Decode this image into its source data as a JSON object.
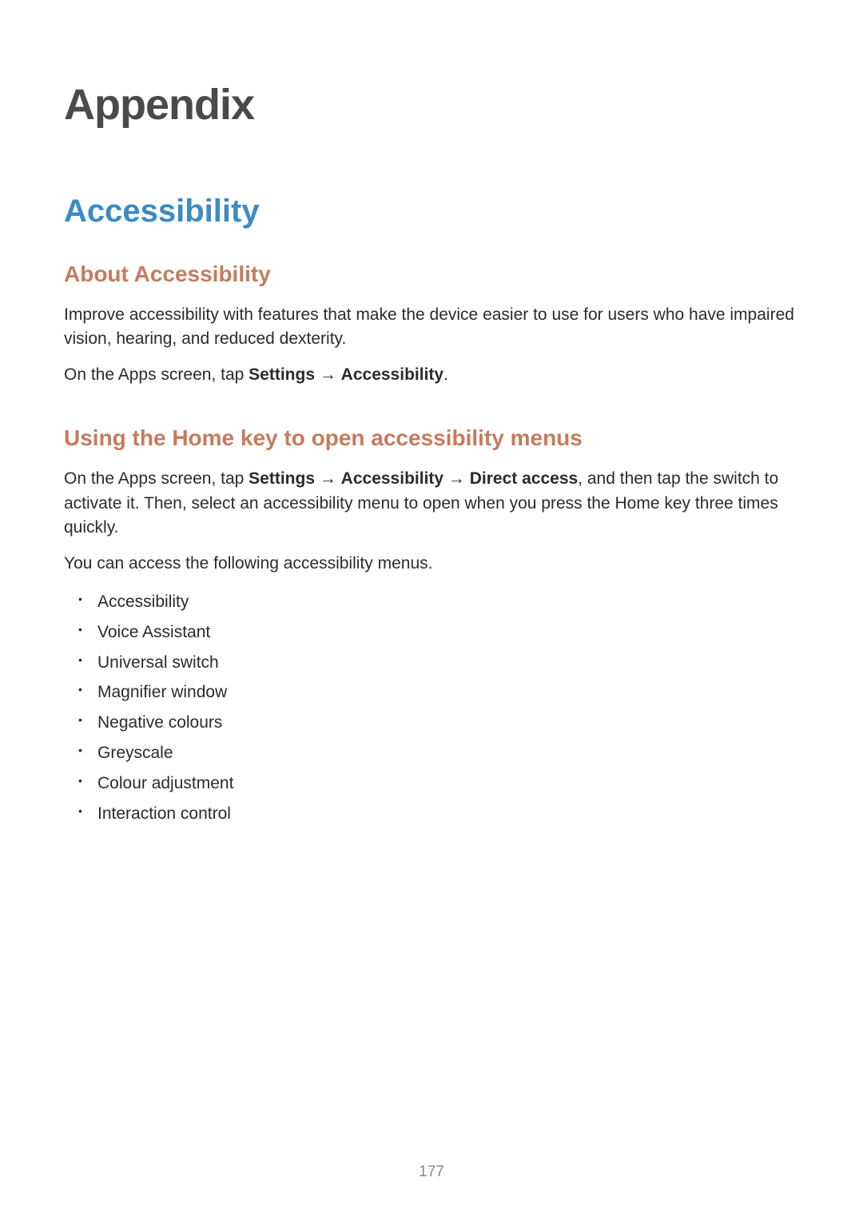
{
  "chapterTitle": "Appendix",
  "sectionTitle": "Accessibility",
  "subsection1": {
    "title": "About Accessibility",
    "para1": "Improve accessibility with features that make the device easier to use for users who have impaired vision, hearing, and reduced dexterity.",
    "para2_prefix": "On the Apps screen, tap ",
    "para2_bold1": "Settings",
    "para2_arrow": " → ",
    "para2_bold2": "Accessibility",
    "para2_suffix": "."
  },
  "subsection2": {
    "title": "Using the Home key to open accessibility menus",
    "para1_prefix": "On the Apps screen, tap ",
    "para1_bold1": "Settings",
    "para1_arrow1": " → ",
    "para1_bold2": "Accessibility",
    "para1_arrow2": " → ",
    "para1_bold3": "Direct access",
    "para1_suffix": ", and then tap the switch to activate it. Then, select an accessibility menu to open when you press the Home key three times quickly.",
    "para2": "You can access the following accessibility menus.",
    "bullets": [
      "Accessibility",
      "Voice Assistant",
      "Universal switch",
      "Magnifier window",
      "Negative colours",
      "Greyscale",
      "Colour adjustment",
      "Interaction control"
    ]
  },
  "pageNumber": "177"
}
